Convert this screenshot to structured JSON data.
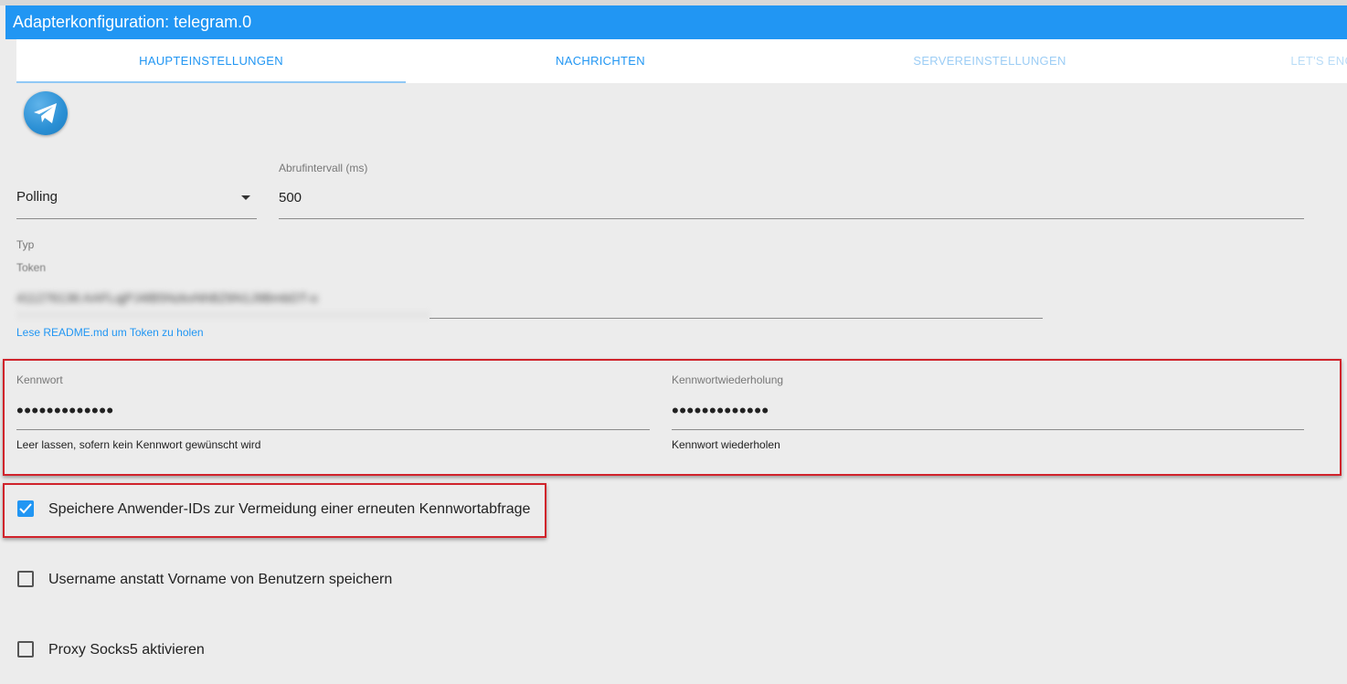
{
  "window": {
    "title": "Adapterkonfiguration: telegram.0"
  },
  "tabs": [
    {
      "label": "HAUPTEINSTELLUNGEN",
      "active": true
    },
    {
      "label": "NACHRICHTEN",
      "active": false
    },
    {
      "label": "SERVEREINSTELLUNGEN",
      "active": false
    },
    {
      "label": "LET'S ENCRYPT ZERTIFIKATE",
      "active": false
    }
  ],
  "logo": {
    "icon": "telegram-paper-plane-icon"
  },
  "type_select": {
    "value": "Polling",
    "label": "Typ",
    "icon": "chevron-down-icon"
  },
  "interval": {
    "label": "Abrufintervall (ms)",
    "value": "500"
  },
  "token": {
    "label": "Token",
    "value": "411276136:AAFLqjPJ4lB5NzkxNhBZ6N1J9BmbDT-o",
    "link": "Lese README.md um Token zu holen"
  },
  "password": {
    "label": "Kennwort",
    "value": "•••••••••••••",
    "helper": "Leer lassen, sofern kein Kennwort gewünscht wird"
  },
  "password_repeat": {
    "label": "Kennwortwiederholung",
    "value": "•••••••••••••",
    "helper": "Kennwort wiederholen"
  },
  "checkboxes": [
    {
      "label": "Speichere Anwender-IDs zur Vermeidung einer erneuten Kennwortabfrage",
      "checked": true
    },
    {
      "label": "Username anstatt Vorname von Benutzern speichern",
      "checked": false
    },
    {
      "label": "Proxy Socks5 aktivieren",
      "checked": false
    }
  ],
  "colors": {
    "accent": "#2196f3",
    "highlight_box": "#d0232b"
  }
}
